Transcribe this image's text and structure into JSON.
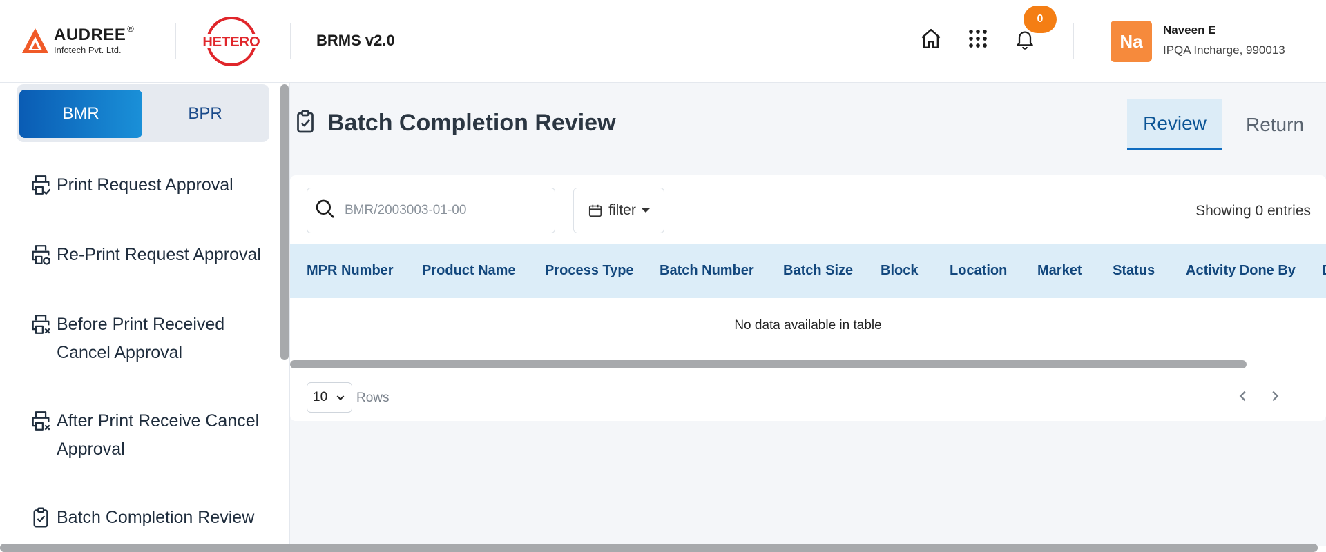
{
  "header": {
    "brand_name": "AUDREE",
    "brand_mark": "®",
    "brand_sub": "Infotech Pvt. Ltd.",
    "partner_logo": "HETERO",
    "app_title": "BRMS v2.0",
    "icons": [
      "home-icon",
      "apps-grid-icon",
      "bell-icon"
    ],
    "notification_count": "0",
    "user": {
      "initials": "Na",
      "name": "Naveen E",
      "role": "IPQA Incharge, 990013"
    },
    "colors": {
      "badge": "#f47e14",
      "avatar": "#f68a3c"
    }
  },
  "sidebar": {
    "segments": [
      {
        "label": "BMR",
        "active": true
      },
      {
        "label": "BPR",
        "active": false
      }
    ],
    "items": [
      {
        "label": "Print Request Approval",
        "icon": "printer-check-icon"
      },
      {
        "label": "Re-Print Request Approval",
        "icon": "printer-refresh-icon"
      },
      {
        "label": "Before Print Received Cancel Approval",
        "icon": "printer-cancel-icon"
      },
      {
        "label": "After Print Receive Cancel Approval",
        "icon": "printer-cancel-icon"
      },
      {
        "label": "Batch Completion Review",
        "icon": "clipboard-check-icon"
      }
    ]
  },
  "main": {
    "title": "Batch Completion Review",
    "title_icon": "clipboard-check-icon",
    "tabs": [
      {
        "label": "Review",
        "active": true
      },
      {
        "label": "Return",
        "active": false
      }
    ],
    "search": {
      "placeholder": "BMR/2003003-01-00",
      "value": ""
    },
    "filter_label": "filter",
    "showing_text": "Showing 0 entries",
    "table": {
      "columns": [
        "MPR Number",
        "Product Name",
        "Process Type",
        "Batch Number",
        "Batch Size",
        "Block",
        "Location",
        "Market",
        "Status",
        "Activity Done By",
        "D"
      ],
      "rows": [],
      "empty_text": "No data available in table"
    },
    "rows_per_page": "10",
    "rows_label": "Rows",
    "accent": "#0f6cc0",
    "header_bg": "#dcedf8"
  }
}
